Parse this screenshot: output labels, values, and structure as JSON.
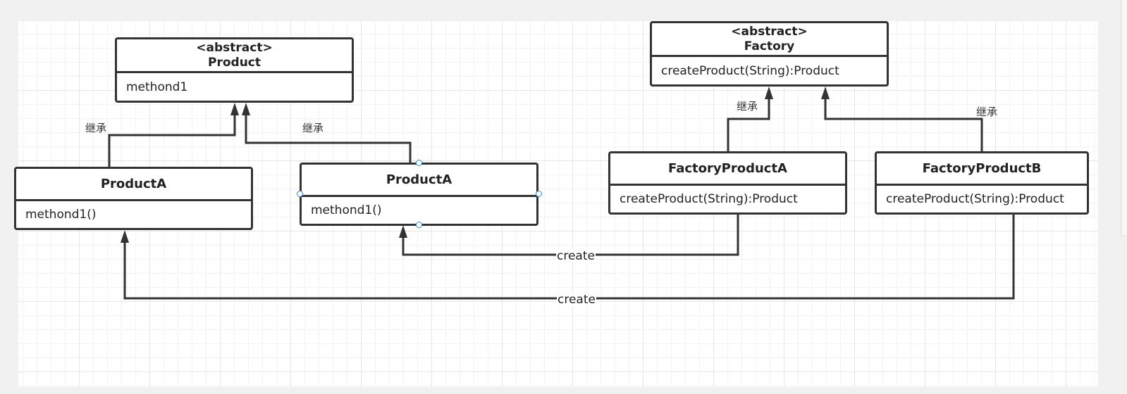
{
  "product": {
    "stereotype": "<abstract>",
    "name": "Product",
    "member": "methond1"
  },
  "factory": {
    "stereotype": "<abstract>",
    "name": "Factory",
    "member": "createProduct(String):Product"
  },
  "product_a_left": {
    "name": "ProductA",
    "member": "methond1()"
  },
  "product_a_right": {
    "name": "ProductA",
    "member": "methond1()"
  },
  "factory_product_a": {
    "name": "FactoryProductA",
    "member": "createProduct(String):Product"
  },
  "factory_product_b": {
    "name": "FactoryProductB",
    "member": "createProduct(String):Product"
  },
  "edges": {
    "inherit_label": "继承",
    "create_label": "create"
  },
  "colors": {
    "stroke": "#333333",
    "selection_handle": "#2b8ae6",
    "grid": "#e6e6e6"
  }
}
